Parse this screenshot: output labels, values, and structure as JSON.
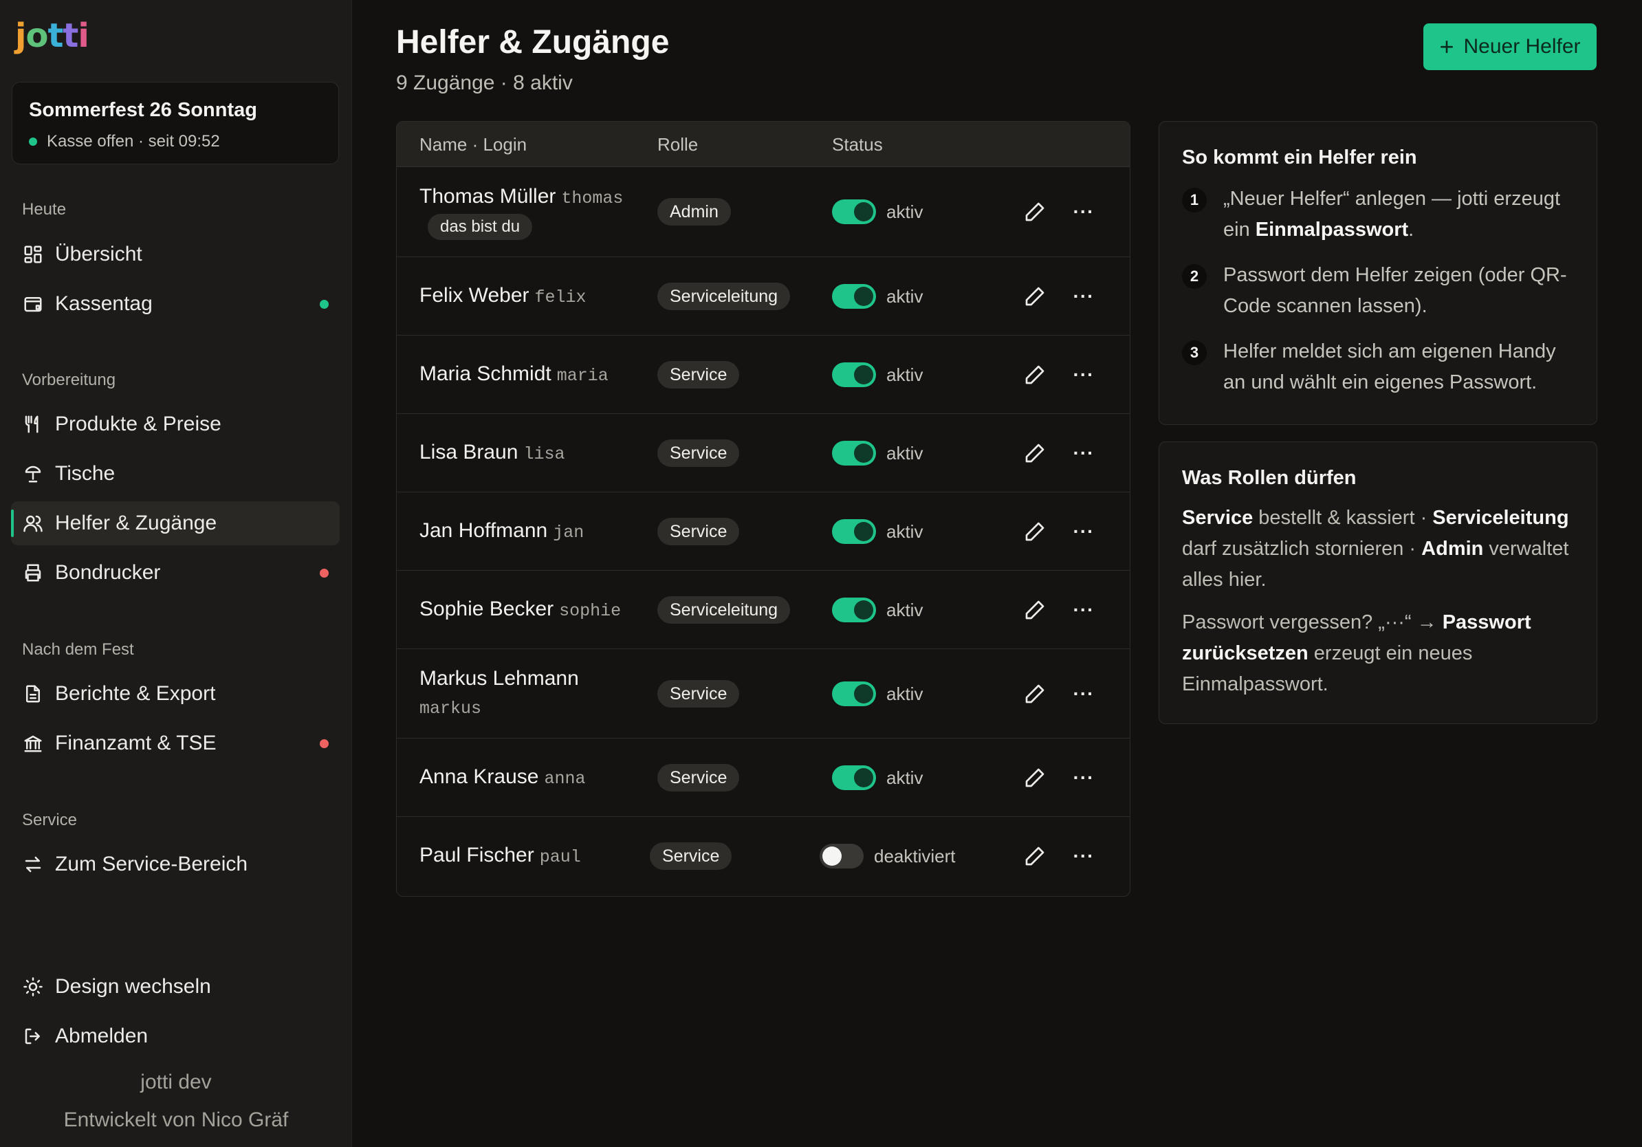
{
  "app": {
    "logo_letters": [
      "j",
      "o",
      "t",
      "t",
      "i"
    ]
  },
  "event": {
    "title": "Sommerfest 26 Sonntag",
    "status": "Kasse offen · seit 09:52",
    "status_color": "#1ec48a"
  },
  "sidebar": {
    "sections": [
      {
        "label": "Heute"
      },
      {
        "label": "Vorbereitung"
      },
      {
        "label": "Nach dem Fest"
      },
      {
        "label": "Service"
      }
    ],
    "items": [
      {
        "label": "Übersicht",
        "icon": "grid-icon"
      },
      {
        "label": "Kassentag",
        "icon": "register-icon",
        "dot_color": "#1ec48a"
      },
      {
        "label": "Produkte & Preise",
        "icon": "fork-knife-icon"
      },
      {
        "label": "Tische",
        "icon": "table-icon"
      },
      {
        "label": "Helfer & Zugänge",
        "icon": "users-icon",
        "active": true
      },
      {
        "label": "Bondrucker",
        "icon": "printer-icon",
        "dot_color": "#f06262"
      },
      {
        "label": "Berichte & Export",
        "icon": "document-icon"
      },
      {
        "label": "Finanzamt & TSE",
        "icon": "bank-icon",
        "dot_color": "#f06262"
      },
      {
        "label": "Zum Service-Bereich",
        "icon": "swap-icon"
      }
    ],
    "bottom": [
      {
        "label": "Design wechseln",
        "icon": "sun-icon"
      },
      {
        "label": "Abmelden",
        "icon": "logout-icon"
      }
    ],
    "footer": {
      "version": "jotti dev",
      "credit": "Entwickelt von Nico Gräf"
    }
  },
  "header": {
    "title": "Helfer & Zugänge",
    "subtitle": "9 Zugänge · 8 aktiv",
    "new_button": "Neuer Helfer"
  },
  "table": {
    "columns": [
      "Name · Login",
      "Rolle",
      "Status"
    ],
    "you_label": "das bist du",
    "rows": [
      {
        "name": "Thomas Müller",
        "login": "thomas",
        "role": "Admin",
        "status": "aktiv",
        "active": true,
        "you": true
      },
      {
        "name": "Felix Weber",
        "login": "felix",
        "role": "Serviceleitung",
        "status": "aktiv",
        "active": true
      },
      {
        "name": "Maria Schmidt",
        "login": "maria",
        "role": "Service",
        "status": "aktiv",
        "active": true
      },
      {
        "name": "Lisa Braun",
        "login": "lisa",
        "role": "Service",
        "status": "aktiv",
        "active": true
      },
      {
        "name": "Jan Hoffmann",
        "login": "jan",
        "role": "Service",
        "status": "aktiv",
        "active": true
      },
      {
        "name": "Sophie Becker",
        "login": "sophie",
        "role": "Serviceleitung",
        "status": "aktiv",
        "active": true
      },
      {
        "name": "Markus Lehmann",
        "login": "markus",
        "role": "Service",
        "status": "aktiv",
        "active": true,
        "login_below": true
      },
      {
        "name": "Anna Krause",
        "login": "anna",
        "role": "Service",
        "status": "aktiv",
        "active": true
      },
      {
        "name": "Paul Fischer",
        "login": "paul",
        "role": "Service",
        "status": "deaktiviert",
        "active": false
      }
    ]
  },
  "help_card": {
    "title": "So kommt ein Helfer rein",
    "steps": [
      {
        "num": "1",
        "text_before": "„Neuer Helfer“ anlegen — jotti erzeugt ein ",
        "bold": "Einmalpasswort",
        "text_after": "."
      },
      {
        "num": "2",
        "text_before": "Passwort dem Helfer zeigen (oder QR-Code scannen lassen).",
        "bold": "",
        "text_after": ""
      },
      {
        "num": "3",
        "text_before": "Helfer meldet sich am eigenen Handy an und wählt ein eigenes Passwort.",
        "bold": "",
        "text_after": ""
      }
    ]
  },
  "roles_card": {
    "title": "Was Rollen dürfen",
    "p1": {
      "b1": "Service",
      "t1": " bestellt & kassiert · ",
      "b2": "Serviceleitung",
      "t2": " darf zusätzlich stornieren · ",
      "b3": "Admin",
      "t3": " verwaltet alles hier."
    },
    "p2": {
      "t1": "Passwort vergessen? „···“ → ",
      "b1": "Passwort zurücksetzen",
      "t2": " erzeugt ein neues Einmalpasswort."
    }
  },
  "colors": {
    "accent": "#1ec48a",
    "warning_dot": "#f06262"
  }
}
